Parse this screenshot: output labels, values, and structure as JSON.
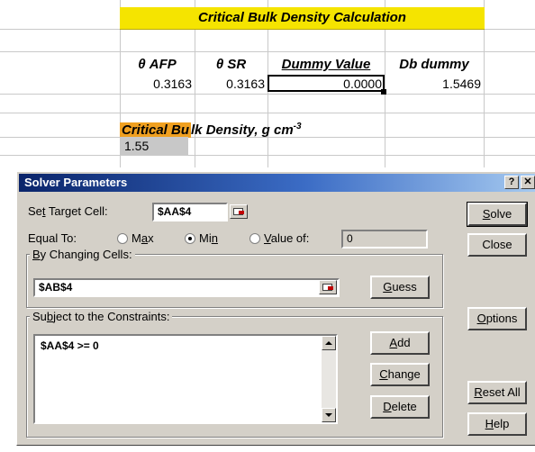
{
  "sheet": {
    "title": "Critical Bulk Density Calculation",
    "headers": [
      "θ AFP",
      "θ SR",
      "Dummy Value",
      "Db dummy"
    ],
    "values": [
      "0.3163",
      "0.3163",
      "0.0000",
      "1.5469"
    ],
    "cbd_label_hl": "Critical Bu",
    "cbd_label_rest": "lk Density, g cm",
    "cbd_label_sup": "-3",
    "cbd_value": "1.55"
  },
  "dialog": {
    "title": "Solver Parameters",
    "help_btn": "?",
    "close_btn": "✕",
    "set_target_label_pre": "Se",
    "set_target_label_ul": "t",
    "set_target_label_post": " Target Cell:",
    "target_cell": "$AA$4",
    "equal_to_label": "Equal To:",
    "radio_max_pre": "M",
    "radio_max_ul": "a",
    "radio_max_post": "x",
    "radio_min_pre": "Mi",
    "radio_min_ul": "n",
    "radio_value_pre": "",
    "radio_value_ul": "V",
    "radio_value_post": "alue of:",
    "value_of": "0",
    "changing_cells_ul": "B",
    "changing_cells_post": "y Changing Cells:",
    "changing_cells": "$AB$4",
    "guess_btn_ul": "G",
    "guess_btn_post": "uess",
    "constraints_pre": "Su",
    "constraints_ul": "b",
    "constraints_post": "ject to the Constraints:",
    "constraints": [
      "$AA$4 >= 0"
    ],
    "add_btn_ul": "A",
    "add_btn_post": "dd",
    "change_btn_ul": "C",
    "change_btn_post": "hange",
    "delete_btn_ul": "D",
    "delete_btn_post": "elete",
    "solve_btn_ul": "S",
    "solve_btn_post": "olve",
    "close_label": "Close",
    "options_ul": "O",
    "options_post": "ptions",
    "reset_ul": "R",
    "reset_post": "eset All",
    "help_pre": "",
    "help_ul": "H",
    "help_post": "elp"
  }
}
